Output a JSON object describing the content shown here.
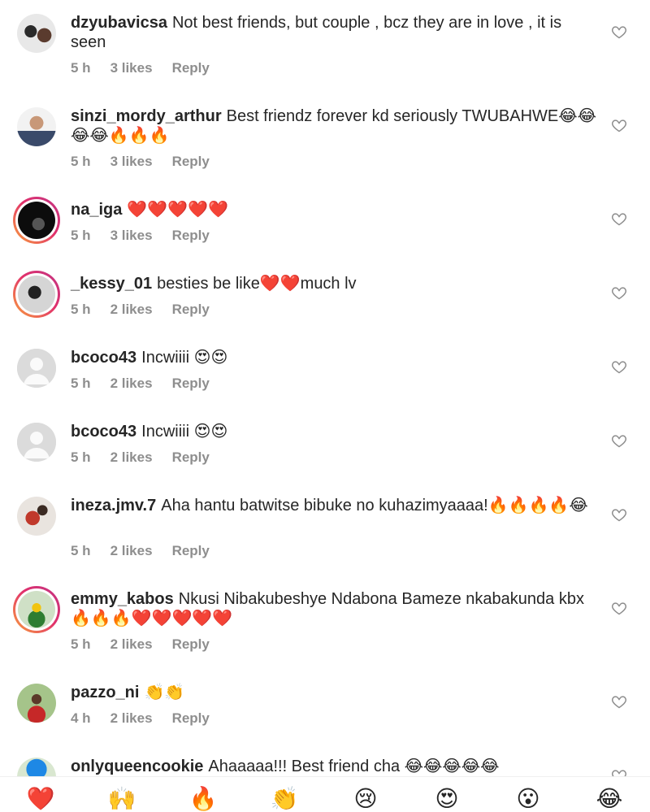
{
  "comments": [
    {
      "username": "dzyubavicsa",
      "text": "Not best friends, but couple , bcz they are in love , it is seen",
      "time": "5 h",
      "likes": "3 likes",
      "reply": "Reply",
      "avatar_style": "photo-light"
    },
    {
      "username": "sinzi_mordy_arthur",
      "text": "Best friendz forever kd seriously TWUBAHWE😂😂😂😂🔥🔥🔥",
      "time": "5 h",
      "likes": "3 likes",
      "reply": "Reply",
      "avatar_style": "photo-light"
    },
    {
      "username": "na_iga",
      "text": "❤️❤️❤️❤️❤️",
      "time": "5 h",
      "likes": "3 likes",
      "reply": "Reply",
      "avatar_style": "story-dark"
    },
    {
      "username": "_kessy_01",
      "text": "besties be like❤️❤️much lv",
      "time": "5 h",
      "likes": "2 likes",
      "reply": "Reply",
      "avatar_style": "story-grey"
    },
    {
      "username": "bcoco43",
      "text": "Incwiiii 😍😍",
      "time": "5 h",
      "likes": "2 likes",
      "reply": "Reply",
      "avatar_style": "default"
    },
    {
      "username": "bcoco43",
      "text": "Incwiiii 😍😍",
      "time": "5 h",
      "likes": "2 likes",
      "reply": "Reply",
      "avatar_style": "default"
    },
    {
      "username": "ineza.jmv.7",
      "text": "Aha hantu batwitse bibuke no kuhazimyaaaa!🔥🔥🔥🔥😂",
      "time": "5 h",
      "likes": "2 likes",
      "reply": "Reply",
      "avatar_style": "photo-red"
    },
    {
      "username": "emmy_kabos",
      "text": "Nkusi Nibakubeshye Ndabona Bameze nkabakunda kbx🔥🔥🔥❤️❤️❤️❤️❤️",
      "time": "5 h",
      "likes": "2 likes",
      "reply": "Reply",
      "avatar_style": "story-green"
    },
    {
      "username": "pazzo_ni",
      "text": "👏👏",
      "time": "4 h",
      "likes": "2 likes",
      "reply": "Reply",
      "avatar_style": "photo-green"
    },
    {
      "username": "onlyqueencookie",
      "text": "Ahaaaaa!!! Best friend cha 😂😂😂😂😂",
      "time": "",
      "likes": "",
      "reply": "",
      "avatar_style": "photo-blue"
    }
  ],
  "emoji_bar": [
    "❤️",
    "🙌",
    "🔥",
    "👏",
    "😢",
    "😍",
    "😮",
    "😂"
  ],
  "colors": {
    "meta": "#8e8e8e",
    "text": "#262626",
    "story_ring_start": "#f9a13c",
    "story_ring_end": "#c13584"
  }
}
